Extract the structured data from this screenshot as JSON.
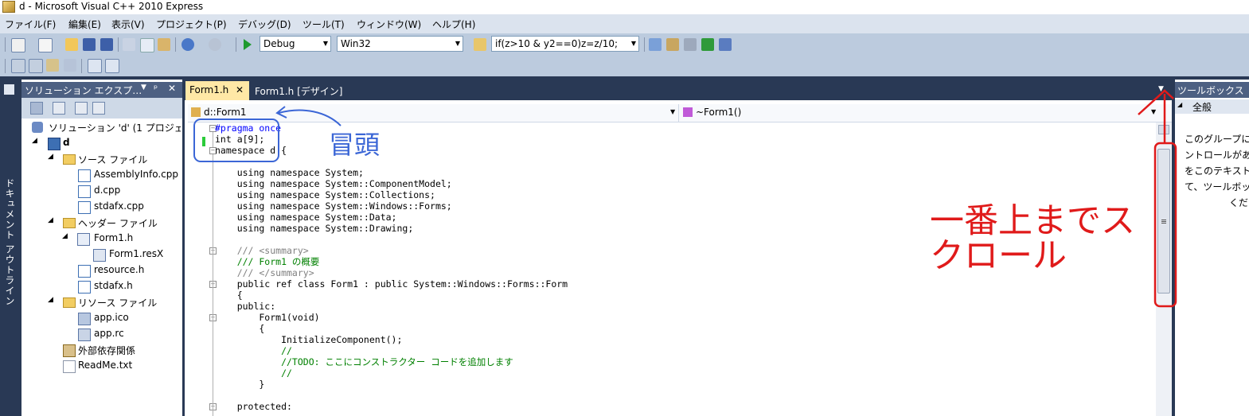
{
  "window": {
    "title": "d - Microsoft Visual C++ 2010 Express"
  },
  "menu": [
    "ファイル(F)",
    "編集(E)",
    "表示(V)",
    "プロジェクト(P)",
    "デバッグ(D)",
    "ツール(T)",
    "ウィンドウ(W)",
    "ヘルプ(H)"
  ],
  "toolbar": {
    "config_combo": "Debug",
    "platform_combo": "Win32",
    "find_combo": "if(z>10 & y2==0)z=z/10;"
  },
  "solution_explorer": {
    "title": "ソリューション エクスプ…",
    "pin_glyph": "ᵖ",
    "close_glyph": "✕",
    "items": [
      {
        "label": "ソリューション 'd' (1 プロジェ",
        "icon": "solution-icon"
      },
      {
        "label": "d",
        "icon": "project-icon"
      },
      {
        "label": "ソース ファイル",
        "icon": "folder-icon"
      },
      {
        "label": "AssemblyInfo.cpp",
        "icon": "cpp-file-icon"
      },
      {
        "label": "d.cpp",
        "icon": "cpp-file-icon"
      },
      {
        "label": "stdafx.cpp",
        "icon": "cpp-file-icon"
      },
      {
        "label": "ヘッダー ファイル",
        "icon": "folder-icon"
      },
      {
        "label": "Form1.h",
        "icon": "form-icon"
      },
      {
        "label": "Form1.resX",
        "icon": "resx-icon"
      },
      {
        "label": "resource.h",
        "icon": "header-file-icon"
      },
      {
        "label": "stdafx.h",
        "icon": "header-file-icon"
      },
      {
        "label": "リソース ファイル",
        "icon": "folder-icon"
      },
      {
        "label": "app.ico",
        "icon": "ico-file-icon"
      },
      {
        "label": "app.rc",
        "icon": "rc-file-icon"
      },
      {
        "label": "外部依存関係",
        "icon": "dependencies-icon"
      },
      {
        "label": "ReadMe.txt",
        "icon": "text-file-icon"
      }
    ]
  },
  "document_outline": {
    "label": "ドキュメント アウトライン"
  },
  "editor": {
    "tabs": [
      {
        "label": "Form1.h",
        "close": "✕"
      },
      {
        "label": "Form1.h [デザイン]"
      }
    ],
    "nav_left": "d::Form1",
    "nav_right": "~Form1()",
    "code": [
      "#pragma once",
      "int a[9];",
      "namespace d {",
      "",
      "    using namespace System;",
      "    using namespace System::ComponentModel;",
      "    using namespace System::Collections;",
      "    using namespace System::Windows::Forms;",
      "    using namespace System::Data;",
      "    using namespace System::Drawing;",
      "",
      "    /// <summary>",
      "    /// Form1 の概要",
      "    /// </summary>",
      "    public ref class Form1 : public System::Windows::Forms::Form",
      "    {",
      "    public:",
      "        Form1(void)",
      "        {",
      "            InitializeComponent();",
      "            //",
      "            //TODO: ここにコンストラクター コードを追加します",
      "            //",
      "        }",
      "",
      "    protected:"
    ]
  },
  "toolbox": {
    "title": "ツールボックス",
    "group": "全般",
    "text_lines": [
      "このグループに",
      "ントロールがあ",
      "をこのテキスト",
      "て、ツールボッ",
      "くだ"
    ]
  },
  "annotations": {
    "top_label": "冒頭",
    "scroll_label_line1": "一番上までス",
    "scroll_label_line2": "クロール"
  },
  "colors": {
    "annotation_red": "#e01a1a",
    "annotation_blue": "#3b66d6",
    "ide_dark": "#293955",
    "tab_active": "#ffe8a6"
  }
}
